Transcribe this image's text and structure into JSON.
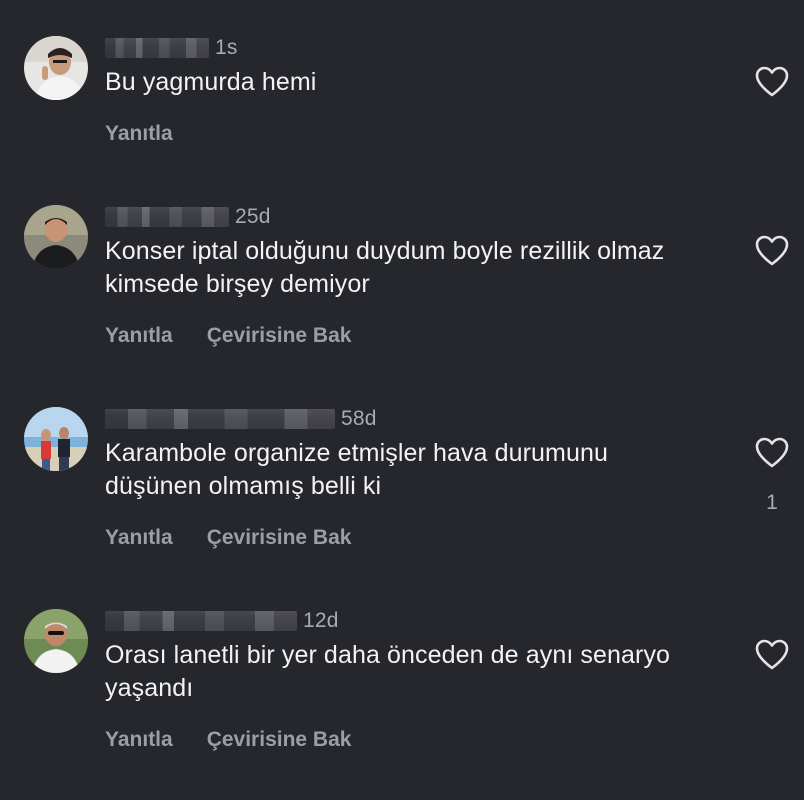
{
  "comments": [
    {
      "time": "1s",
      "text": "Bu yagmurda hemi",
      "actions": [
        "Yanıtla"
      ],
      "like_count": ""
    },
    {
      "time": "25d",
      "text": "Konser iptal olduğunu duydum boyle rezillik olmaz kimsede birşey demiyor",
      "actions": [
        "Yanıtla",
        "Çevirisine Bak"
      ],
      "like_count": ""
    },
    {
      "time": "58d",
      "text": "Karambole organize etmişler hava durumunu düşünen olmamış belli ki",
      "actions": [
        "Yanıtla",
        "Çevirisine Bak"
      ],
      "like_count": "1"
    },
    {
      "time": "12d",
      "text": "Orası lanetli bir yer daha önceden de aynı senaryo yaşandı",
      "actions": [
        "Yanıtla",
        "Çevirisine Bak"
      ],
      "like_count": ""
    }
  ],
  "icons": {
    "like": "heart-outline-icon",
    "avatar": "user-avatar"
  },
  "colors": {
    "background": "#25272c",
    "text_primary": "#f3f3f5",
    "text_secondary": "#9c9ea4"
  }
}
